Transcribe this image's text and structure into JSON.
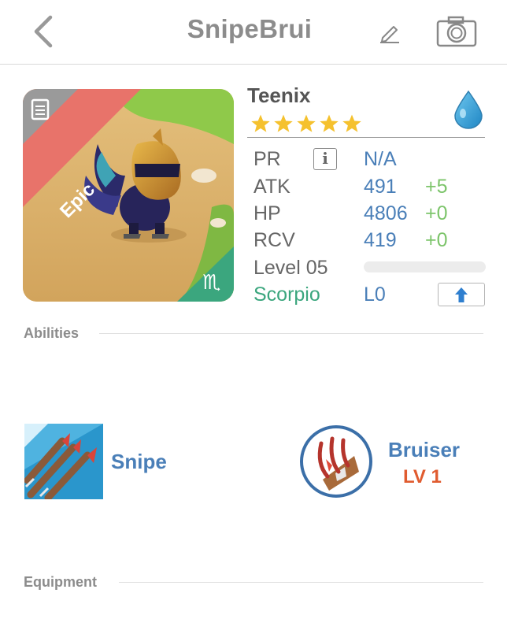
{
  "header": {
    "title": "SnipeBrui",
    "back_icon": "chevron-left-icon",
    "edit_icon": "pencil-icon",
    "camera_icon": "camera-icon"
  },
  "monster": {
    "name": "Teenix",
    "rarity": "Epic",
    "stars": 5,
    "element_icon": "water-drop-icon",
    "zodiac_icon": "scorpio-icon",
    "colors": {
      "epic_banner": "#e8736a",
      "zodiac_badge": "#3ba67e",
      "star": "#f5c12e"
    }
  },
  "stats": {
    "pr": {
      "label": "PR",
      "value": "N/A"
    },
    "atk": {
      "label": "ATK",
      "value": "491",
      "bonus": "+5"
    },
    "hp": {
      "label": "HP",
      "value": "4806",
      "bonus": "+0"
    },
    "rcv": {
      "label": "RCV",
      "value": "419",
      "bonus": "+0"
    },
    "level": {
      "label": "Level 05",
      "progress": 0
    },
    "sign": {
      "label": "Scorpio",
      "value": "L0"
    }
  },
  "abilities": {
    "title": "Abilities",
    "items": [
      {
        "name": "Snipe",
        "icon": "arrows-icon"
      },
      {
        "name": "Bruiser",
        "level": "LV 1",
        "icon": "claw-icon"
      }
    ]
  },
  "equipment": {
    "title": "Equipment"
  }
}
